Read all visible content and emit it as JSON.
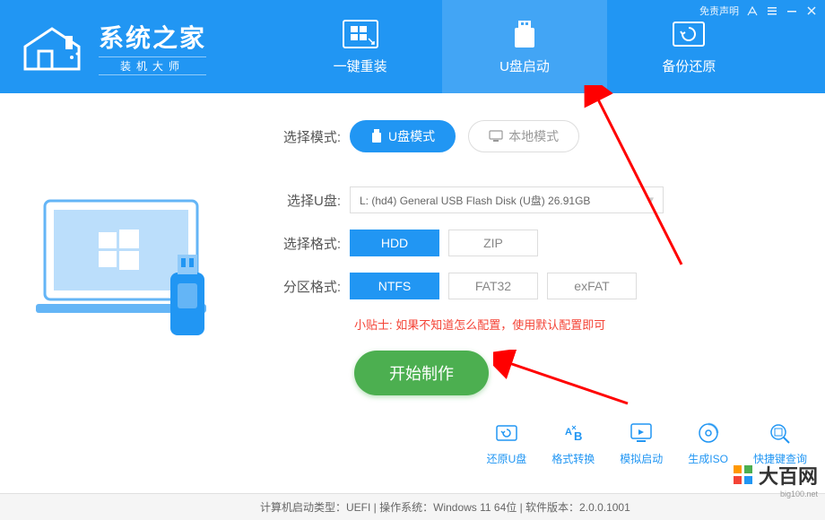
{
  "header": {
    "logo_title": "系统之家",
    "logo_sub": "装机大师",
    "tabs": [
      {
        "label": "一键重装"
      },
      {
        "label": "U盘启动"
      },
      {
        "label": "备份还原"
      }
    ],
    "disclaimer": "免责声明"
  },
  "form": {
    "mode_label": "选择模式:",
    "mode_usb": "U盘模式",
    "mode_local": "本地模式",
    "usb_label": "选择U盘:",
    "usb_value": "L: (hd4) General USB Flash Disk  (U盘) 26.91GB",
    "format_label": "选择格式:",
    "format_hdd": "HDD",
    "format_zip": "ZIP",
    "partition_label": "分区格式:",
    "partition_ntfs": "NTFS",
    "partition_fat32": "FAT32",
    "partition_exfat": "exFAT",
    "tip_label": "小贴士: ",
    "tip_text": "如果不知道怎么配置，使用默认配置即可",
    "start": "开始制作"
  },
  "tools": {
    "restore": "还原U盘",
    "convert": "格式转换",
    "simulate": "模拟启动",
    "iso": "生成ISO",
    "hotkey": "快捷键查询"
  },
  "status": {
    "text": "计算机启动类型：UEFI  |  操作系统：Windows 11 64位  |  软件版本：2.0.0.1001"
  },
  "watermark": {
    "text": "大百网",
    "sub": "big100.net"
  }
}
